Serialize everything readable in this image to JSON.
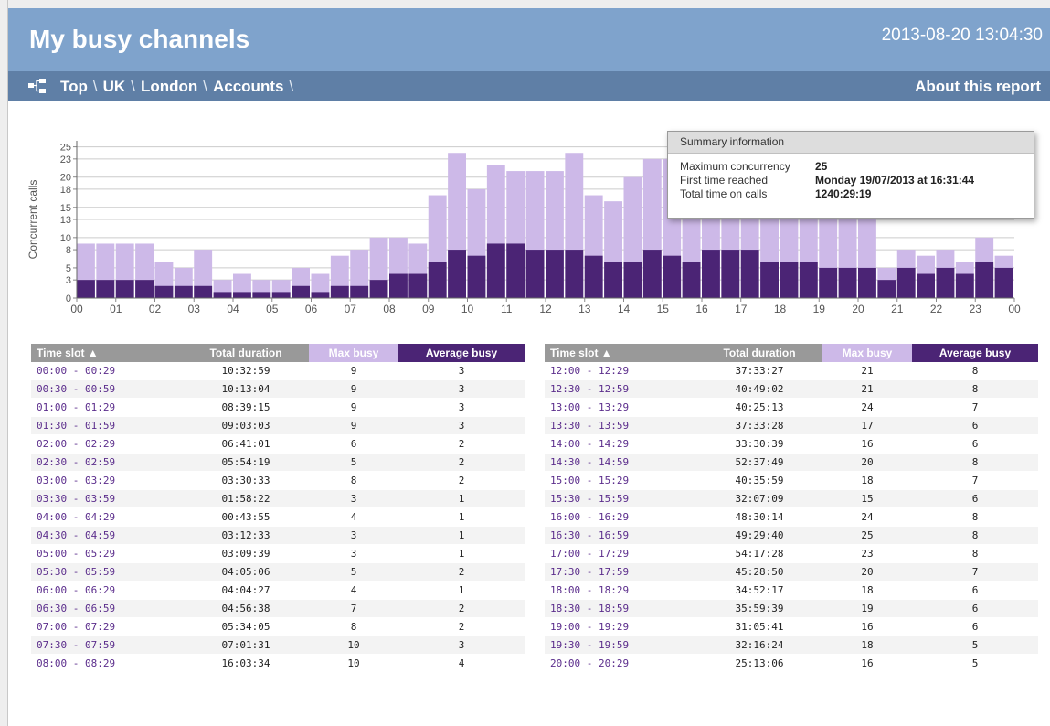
{
  "header": {
    "title": "My busy channels",
    "datetime": "2013-08-20 13:04:30"
  },
  "nav": {
    "crumbs": [
      "Top",
      "UK",
      "London",
      "Accounts"
    ],
    "separator": "\\",
    "about": "About this report",
    "icon": "hierarchy-icon"
  },
  "summary": {
    "heading": "Summary information",
    "rows": [
      {
        "label": "Maximum concurrency",
        "value": "25"
      },
      {
        "label": "First time reached",
        "value": "Monday 19/07/2013 at 16:31:44"
      },
      {
        "label": "Total time on calls",
        "value": "1240:29:19"
      }
    ]
  },
  "chart_data": {
    "type": "bar",
    "ylabel": "Concurrent calls",
    "ylim": [
      0,
      26
    ],
    "yticks": [
      0,
      3,
      5,
      8,
      10,
      13,
      15,
      18,
      20,
      23,
      25
    ],
    "xticks": [
      "00",
      "01",
      "02",
      "03",
      "04",
      "05",
      "06",
      "07",
      "08",
      "09",
      "10",
      "11",
      "12",
      "13",
      "14",
      "15",
      "16",
      "17",
      "18",
      "19",
      "20",
      "21",
      "22",
      "23",
      "00"
    ],
    "colors": {
      "max": "#cdb9e8",
      "avg": "#4b2475",
      "grid": "#cccccc"
    },
    "series": [
      {
        "name": "Max busy",
        "values": [
          9,
          9,
          9,
          9,
          6,
          5,
          8,
          3,
          4,
          3,
          3,
          5,
          4,
          7,
          8,
          10,
          10,
          9,
          17,
          24,
          18,
          22,
          21,
          21,
          21,
          24,
          17,
          16,
          20,
          23,
          23,
          23,
          23,
          23,
          20,
          21,
          21,
          21,
          21,
          21,
          21,
          5,
          8,
          7,
          8,
          6,
          10,
          7
        ]
      },
      {
        "name": "Average busy",
        "values": [
          3,
          3,
          3,
          3,
          2,
          2,
          2,
          1,
          1,
          1,
          1,
          2,
          1,
          2,
          2,
          3,
          4,
          4,
          6,
          8,
          7,
          9,
          9,
          8,
          8,
          8,
          7,
          6,
          6,
          8,
          7,
          6,
          8,
          8,
          8,
          6,
          6,
          6,
          5,
          5,
          5,
          3,
          5,
          4,
          5,
          4,
          6,
          5
        ]
      }
    ]
  },
  "tables": {
    "headers": {
      "slot": "Time slot ▲",
      "duration": "Total duration",
      "max": "Max busy",
      "avg": "Average busy"
    },
    "left": [
      [
        "00:00 - 00:29",
        "10:32:59",
        "9",
        "3"
      ],
      [
        "00:30 - 00:59",
        "10:13:04",
        "9",
        "3"
      ],
      [
        "01:00 - 01:29",
        "08:39:15",
        "9",
        "3"
      ],
      [
        "01:30 - 01:59",
        "09:03:03",
        "9",
        "3"
      ],
      [
        "02:00 - 02:29",
        "06:41:01",
        "6",
        "2"
      ],
      [
        "02:30 - 02:59",
        "05:54:19",
        "5",
        "2"
      ],
      [
        "03:00 - 03:29",
        "03:30:33",
        "8",
        "2"
      ],
      [
        "03:30 - 03:59",
        "01:58:22",
        "3",
        "1"
      ],
      [
        "04:00 - 04:29",
        "00:43:55",
        "4",
        "1"
      ],
      [
        "04:30 - 04:59",
        "03:12:33",
        "3",
        "1"
      ],
      [
        "05:00 - 05:29",
        "03:09:39",
        "3",
        "1"
      ],
      [
        "05:30 - 05:59",
        "04:05:06",
        "5",
        "2"
      ],
      [
        "06:00 - 06:29",
        "04:04:27",
        "4",
        "1"
      ],
      [
        "06:30 - 06:59",
        "04:56:38",
        "7",
        "2"
      ],
      [
        "07:00 - 07:29",
        "05:34:05",
        "8",
        "2"
      ],
      [
        "07:30 - 07:59",
        "07:01:31",
        "10",
        "3"
      ],
      [
        "08:00 - 08:29",
        "16:03:34",
        "10",
        "4"
      ]
    ],
    "right": [
      [
        "12:00 - 12:29",
        "37:33:27",
        "21",
        "8"
      ],
      [
        "12:30 - 12:59",
        "40:49:02",
        "21",
        "8"
      ],
      [
        "13:00 - 13:29",
        "40:25:13",
        "24",
        "7"
      ],
      [
        "13:30 - 13:59",
        "37:33:28",
        "17",
        "6"
      ],
      [
        "14:00 - 14:29",
        "33:30:39",
        "16",
        "6"
      ],
      [
        "14:30 - 14:59",
        "52:37:49",
        "20",
        "8"
      ],
      [
        "15:00 - 15:29",
        "40:35:59",
        "18",
        "7"
      ],
      [
        "15:30 - 15:59",
        "32:07:09",
        "15",
        "6"
      ],
      [
        "16:00 - 16:29",
        "48:30:14",
        "24",
        "8"
      ],
      [
        "16:30 - 16:59",
        "49:29:40",
        "25",
        "8"
      ],
      [
        "17:00 - 17:29",
        "54:17:28",
        "23",
        "8"
      ],
      [
        "17:30 - 17:59",
        "45:28:50",
        "20",
        "7"
      ],
      [
        "18:00 - 18:29",
        "34:52:17",
        "18",
        "6"
      ],
      [
        "18:30 - 18:59",
        "35:59:39",
        "19",
        "6"
      ],
      [
        "19:00 - 19:29",
        "31:05:41",
        "16",
        "6"
      ],
      [
        "19:30 - 19:59",
        "32:16:24",
        "18",
        "5"
      ],
      [
        "20:00 - 20:29",
        "25:13:06",
        "16",
        "5"
      ]
    ]
  }
}
